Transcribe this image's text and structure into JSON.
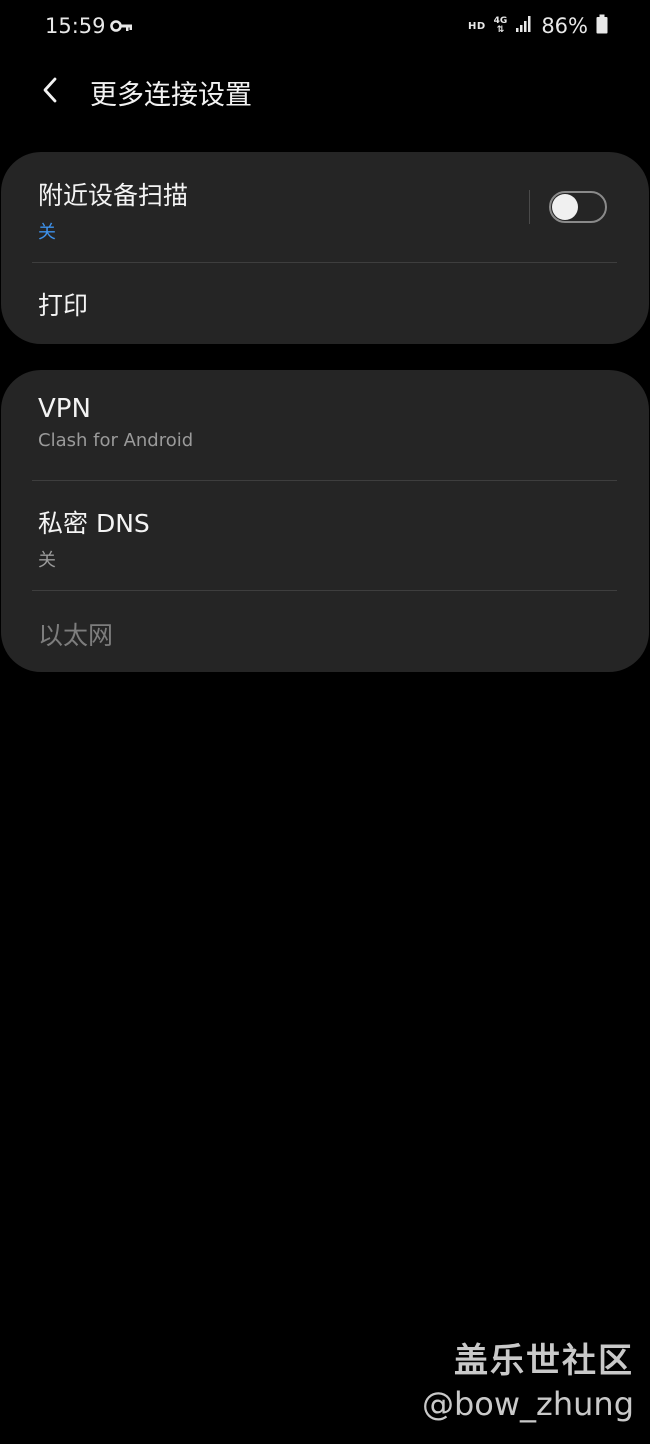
{
  "status_bar": {
    "time": "15:59",
    "hd_label": "HD",
    "network_label": "4G",
    "battery_text": "86%"
  },
  "header": {
    "title": "更多连接设置"
  },
  "card1": {
    "nearby_scan": {
      "title": "附近设备扫描",
      "status": "关",
      "toggle_on": false
    },
    "print": {
      "title": "打印"
    }
  },
  "card2": {
    "vpn": {
      "title": "VPN",
      "subtitle": "Clash for Android"
    },
    "private_dns": {
      "title": "私密 DNS",
      "subtitle": "关"
    },
    "ethernet": {
      "title": "以太网",
      "enabled": false
    }
  },
  "watermark": {
    "line1": "盖乐世社区",
    "line2": "@bow_zhung"
  },
  "colors": {
    "background": "#000000",
    "card": "#252525",
    "accent": "#3e91ea",
    "divider": "#3e3e3e"
  }
}
